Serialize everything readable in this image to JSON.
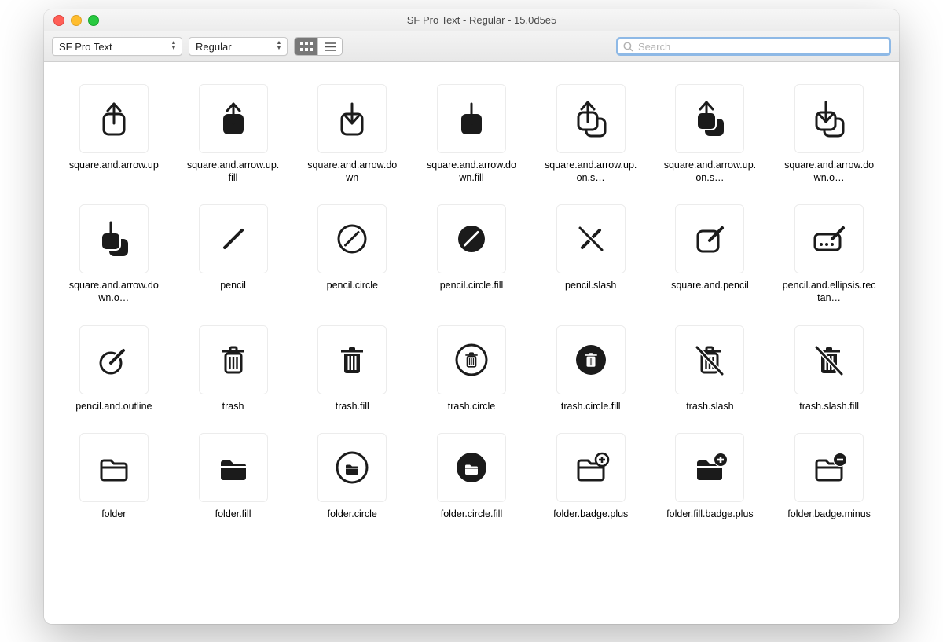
{
  "window": {
    "title": "SF Pro Text - Regular - 15.0d5e5"
  },
  "toolbar": {
    "font_name": "SF Pro Text",
    "font_style": "Regular",
    "view_grid_label": "grid",
    "view_list_label": "list",
    "search_placeholder": "Search",
    "search_value": ""
  },
  "icons": [
    {
      "id": "square.and.arrow.up",
      "label": "square.and.arrow.up"
    },
    {
      "id": "square.and.arrow.up.fill",
      "label": "square.and.arrow.up.fill"
    },
    {
      "id": "square.and.arrow.down",
      "label": "square.and.arrow.down"
    },
    {
      "id": "square.and.arrow.down.fill",
      "label": "square.and.arrow.down.fill"
    },
    {
      "id": "square.and.arrow.up.on.square",
      "label": "square.and.arrow.up.on.s…"
    },
    {
      "id": "square.and.arrow.up.on.square.fill",
      "label": "square.and.arrow.up.on.s…"
    },
    {
      "id": "square.and.arrow.down.on.square",
      "label": "square.and.arrow.down.o…"
    },
    {
      "id": "square.and.arrow.down.on.square.fill",
      "label": "square.and.arrow.down.o…"
    },
    {
      "id": "pencil",
      "label": "pencil"
    },
    {
      "id": "pencil.circle",
      "label": "pencil.circle"
    },
    {
      "id": "pencil.circle.fill",
      "label": "pencil.circle.fill"
    },
    {
      "id": "pencil.slash",
      "label": "pencil.slash"
    },
    {
      "id": "square.and.pencil",
      "label": "square.and.pencil"
    },
    {
      "id": "pencil.and.ellipsis.rectangle",
      "label": "pencil.and.ellipsis.rectan…"
    },
    {
      "id": "pencil.and.outline",
      "label": "pencil.and.outline"
    },
    {
      "id": "trash",
      "label": "trash"
    },
    {
      "id": "trash.fill",
      "label": "trash.fill"
    },
    {
      "id": "trash.circle",
      "label": "trash.circle"
    },
    {
      "id": "trash.circle.fill",
      "label": "trash.circle.fill"
    },
    {
      "id": "trash.slash",
      "label": "trash.slash"
    },
    {
      "id": "trash.slash.fill",
      "label": "trash.slash.fill"
    },
    {
      "id": "folder",
      "label": "folder"
    },
    {
      "id": "folder.fill",
      "label": "folder.fill"
    },
    {
      "id": "folder.circle",
      "label": "folder.circle"
    },
    {
      "id": "folder.circle.fill",
      "label": "folder.circle.fill"
    },
    {
      "id": "folder.badge.plus",
      "label": "folder.badge.plus"
    },
    {
      "id": "folder.fill.badge.plus",
      "label": "folder.fill.badge.plus"
    },
    {
      "id": "folder.badge.minus",
      "label": "folder.badge.minus"
    }
  ]
}
